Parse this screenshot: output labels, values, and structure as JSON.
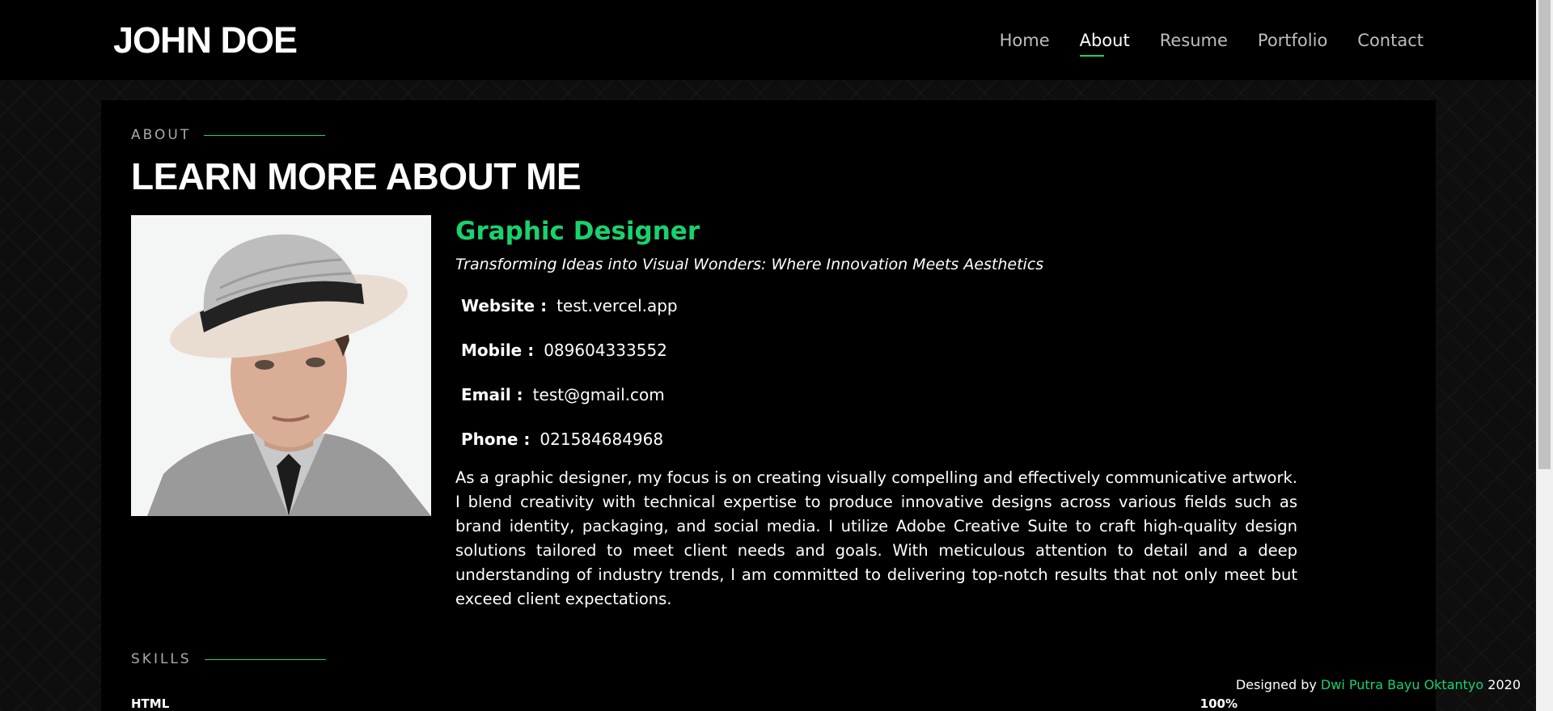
{
  "header": {
    "logo": "JOHN DOE",
    "nav": [
      {
        "label": "Home"
      },
      {
        "label": "About",
        "active": true
      },
      {
        "label": "Resume"
      },
      {
        "label": "Portfolio"
      },
      {
        "label": "Contact"
      }
    ]
  },
  "about": {
    "section_label": "ABOUT",
    "title": "LEARN MORE ABOUT ME",
    "role": "Graphic Designer",
    "tagline": "Transforming Ideas into Visual Wonders: Where Innovation Meets Aesthetics",
    "info": [
      {
        "key": "Website :",
        "value": "test.vercel.app"
      },
      {
        "key": "Mobile :",
        "value": "089604333552"
      },
      {
        "key": "Email :",
        "value": "test@gmail.com"
      },
      {
        "key": "Phone :",
        "value": "021584684968"
      }
    ],
    "bio": "As a graphic designer, my focus is on creating visually compelling and effectively communicative artwork. I blend creativity with technical expertise to produce innovative designs across various fields such as brand identity, packaging, and social media. I utilize Adobe Creative Suite to craft high-quality design solutions tailored to meet client needs and goals. With meticulous attention to detail and a deep understanding of industry trends, I am committed to delivering top-notch results that not only meet but exceed client expectations."
  },
  "skills": {
    "section_label": "SKILLS",
    "items": [
      {
        "name": "HTML",
        "percent": "100%"
      }
    ]
  },
  "credits": {
    "prefix": "Designed by",
    "author": "Dwi Putra Bayu Oktantyo",
    "year": "2020"
  },
  "colors": {
    "accent": "#18d26e",
    "panel": "#000000",
    "text": "#ffffff"
  }
}
